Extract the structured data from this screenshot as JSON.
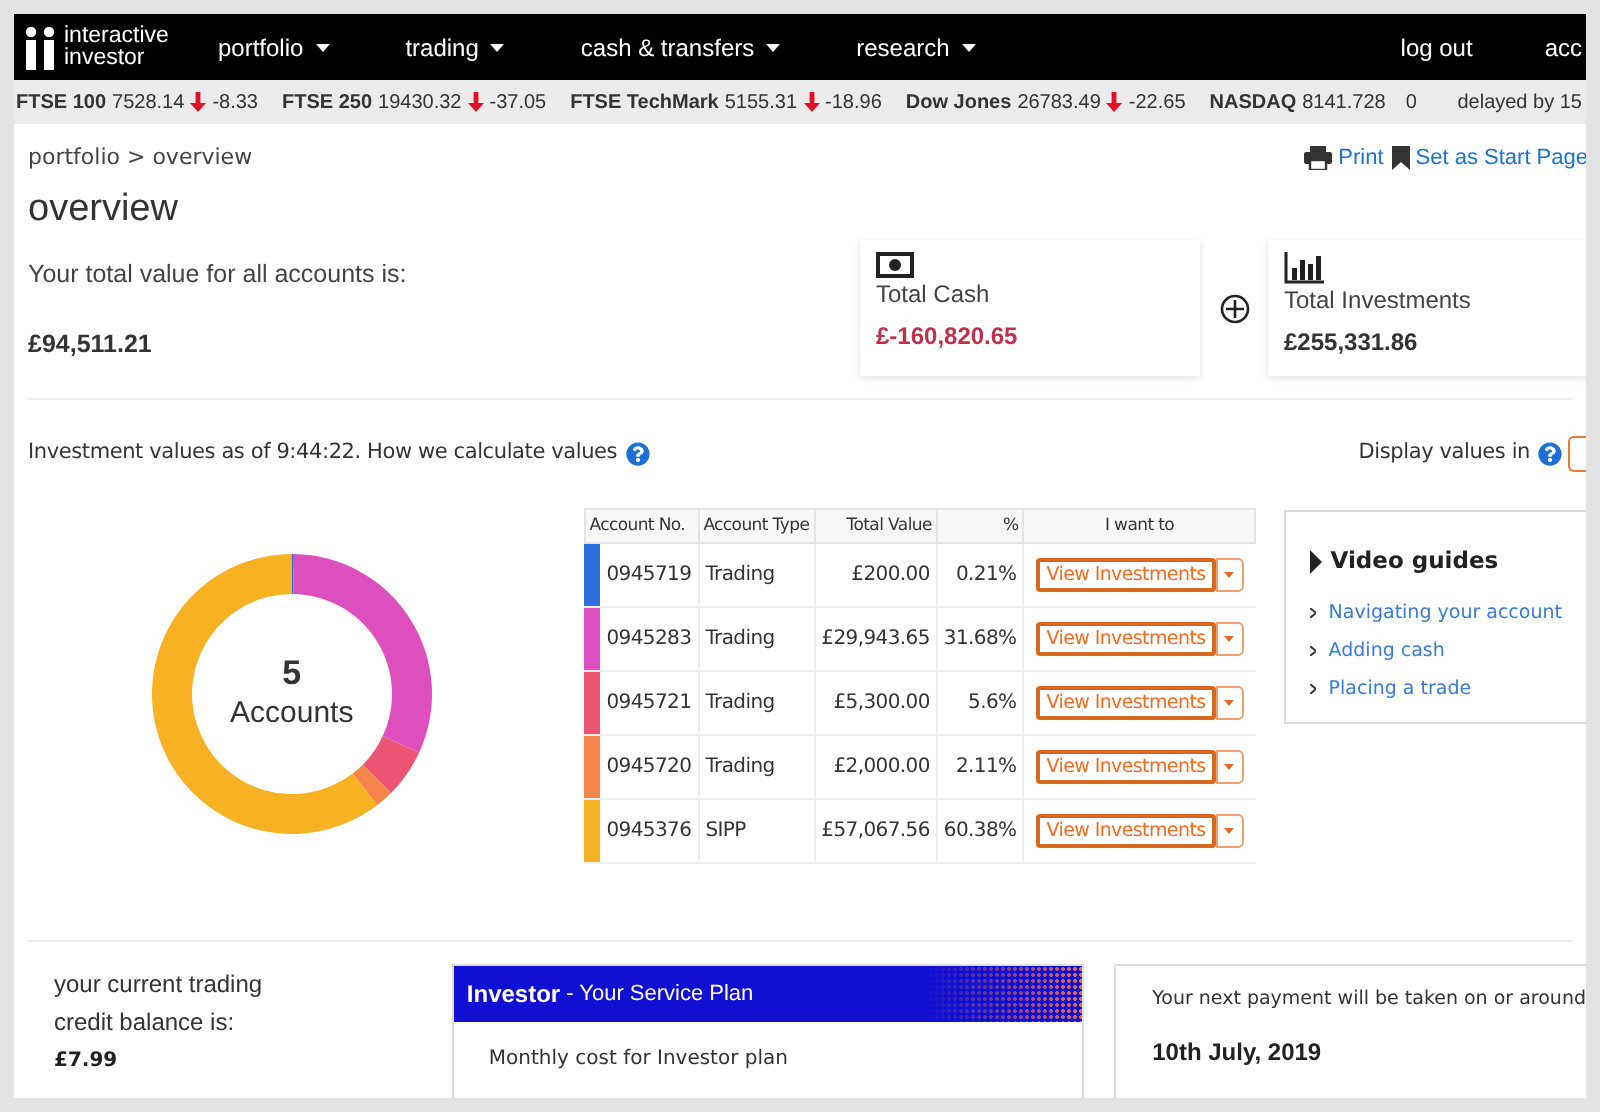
{
  "nav": {
    "logo": [
      "interactive",
      "investor"
    ],
    "menu": [
      {
        "label": "portfolio",
        "dropdown": true
      },
      {
        "label": "trading",
        "dropdown": true
      },
      {
        "label": "cash & transfers",
        "dropdown": true
      },
      {
        "label": "research",
        "dropdown": true
      }
    ],
    "right": [
      "log out",
      "acc"
    ]
  },
  "ticker": {
    "items": [
      {
        "name": "FTSE 100",
        "value": "7528.14",
        "kind": "down",
        "change": "-8.33"
      },
      {
        "name": "FTSE 250",
        "value": "19430.32",
        "kind": "down",
        "change": "-37.05"
      },
      {
        "name": "FTSE TechMark",
        "value": "5155.31",
        "kind": "down",
        "change": "-18.96"
      },
      {
        "name": "Dow Jones",
        "value": "26783.49",
        "kind": "down",
        "change": "-22.65"
      },
      {
        "name": "NASDAQ",
        "value": "8141.728",
        "kind": "flat",
        "change": "0"
      }
    ],
    "delay": "delayed by 15"
  },
  "breadcrumb": "portfolio > overview",
  "actions": [
    {
      "label": "Print"
    },
    {
      "label": "Set as Start Page"
    }
  ],
  "title": "overview",
  "summary": {
    "label": "Your total value for all accounts is:",
    "total": "£94,511.21",
    "cards": [
      {
        "label": "Total Cash",
        "value": "£-160,820.65",
        "negative": true
      },
      {
        "label": "Total Investments",
        "value": "£255,331.86",
        "negative": false
      }
    ]
  },
  "values_note": {
    "text": "Investment values as of 9:44:22. How we calculate values",
    "display_label": "Display values in"
  },
  "accounts": {
    "count": "5",
    "count_label": "Accounts",
    "chart_data": {
      "type": "donut",
      "values": [
        0.21,
        31.68,
        5.6,
        2.11,
        60.38
      ]
    },
    "columns": [
      "Account No.",
      "Account Type",
      "Total Value",
      "%",
      "I want to"
    ],
    "rows": [
      {
        "number": "0945719",
        "type": "Trading",
        "value": "£200.00",
        "pct": "0.21%",
        "action": "View Investments",
        "color": "#2a6fdb"
      },
      {
        "number": "0945283",
        "type": "Trading",
        "value": "£29,943.65",
        "pct": "31.68%",
        "action": "View Investments",
        "color": "#dd4fbd"
      },
      {
        "number": "0945721",
        "type": "Trading",
        "value": "£5,300.00",
        "pct": "5.6%",
        "action": "View Investments",
        "color": "#ec5474"
      },
      {
        "number": "0945720",
        "type": "Trading",
        "value": "£2,000.00",
        "pct": "2.11%",
        "action": "View Investments",
        "color": "#f5844a"
      },
      {
        "number": "0945376",
        "type": "SIPP",
        "value": "£57,067.56",
        "pct": "60.38%",
        "action": "View Investments",
        "color": "#f8b122"
      }
    ]
  },
  "video_guides": {
    "title": "Video guides",
    "links": [
      "Navigating your account",
      "Adding cash",
      "Placing a trade"
    ]
  },
  "credit": {
    "lines": [
      "your current trading",
      "credit balance is:"
    ],
    "amount": "£7.99"
  },
  "plan": {
    "name": "Investor",
    "subtitle": "- Your Service Plan",
    "line": "Monthly cost for Investor plan"
  },
  "payment": {
    "text": "Your next payment will be taken on or around",
    "date": "10th July, 2019"
  }
}
